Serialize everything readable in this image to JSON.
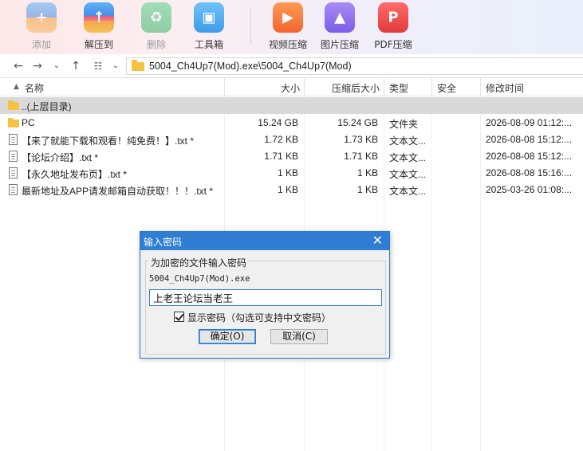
{
  "toolbar": {
    "items": [
      {
        "label": "添加",
        "icon": "add-archive-icon",
        "enabled": false
      },
      {
        "label": "解压到",
        "icon": "extract-to-icon",
        "enabled": true
      },
      {
        "label": "删除",
        "icon": "delete-recycle-icon",
        "enabled": false
      },
      {
        "label": "工具箱",
        "icon": "toolbox-icon",
        "enabled": true
      },
      {
        "label": "视频压缩",
        "icon": "video-compress-icon",
        "enabled": true
      },
      {
        "label": "图片压缩",
        "icon": "image-compress-icon",
        "enabled": true
      },
      {
        "label": "PDF压缩",
        "icon": "pdf-compress-icon",
        "enabled": true
      }
    ]
  },
  "addressbar": {
    "path": "5004_Ch4Up7(Mod).exe\\5004_Ch4Up7(Mod)"
  },
  "list": {
    "columns": [
      "名称",
      "大小",
      "压缩后大小",
      "类型",
      "安全",
      "修改时间"
    ],
    "rows": [
      {
        "name": "..(上层目录)",
        "size": "",
        "packed": "",
        "type": "",
        "security": "",
        "modified": "",
        "icon": "folder-icon"
      },
      {
        "name": "PC",
        "size": "15.24 GB",
        "packed": "15.24 GB",
        "type": "文件夹",
        "security": "",
        "modified": "2026-08-09 01:12:...",
        "icon": "folder-icon"
      },
      {
        "name": "【来了就能下载和观看！纯免费！】.txt *",
        "size": "1.72 KB",
        "packed": "1.73 KB",
        "type": "文本文...",
        "security": "",
        "modified": "2026-08-08 15:12:...",
        "icon": "text-file-icon"
      },
      {
        "name": "【论坛介绍】.txt *",
        "size": "1.71 KB",
        "packed": "1.71 KB",
        "type": "文本文...",
        "security": "",
        "modified": "2026-08-08 15:12:...",
        "icon": "text-file-icon"
      },
      {
        "name": "【永久地址发布页】.txt *",
        "size": "1 KB",
        "packed": "1 KB",
        "type": "文本文...",
        "security": "",
        "modified": "2026-08-08 15:16:...",
        "icon": "text-file-icon"
      },
      {
        "name": "最新地址及APP请发邮箱自动获取！！！.txt *",
        "size": "1 KB",
        "packed": "1 KB",
        "type": "文本文...",
        "security": "",
        "modified": "2025-03-26 01:08:...",
        "icon": "text-file-icon"
      }
    ]
  },
  "dialog": {
    "title": "输入密码",
    "group_label": "为加密的文件输入密码",
    "filename": "5004_Ch4Up7(Mod).exe",
    "password_value": "上老王论坛当老王",
    "show_password_label": "显示密码（勾选可支持中文密码）",
    "show_password_checked": true,
    "ok_label": "确定(O)",
    "cancel_label": "取消(C)"
  },
  "colors": {
    "dialog_title_bar": "#2f7ed3",
    "selected_row": "#d9d9d9",
    "folder": "#f5c242"
  }
}
